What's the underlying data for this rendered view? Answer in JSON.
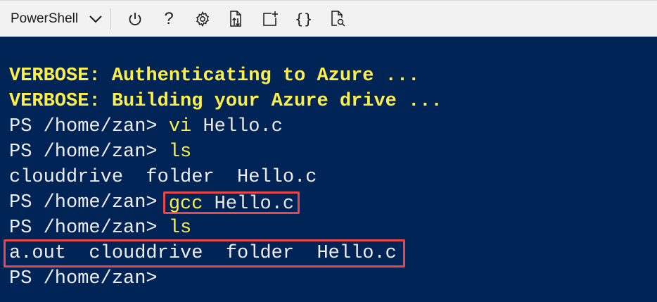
{
  "toolbar": {
    "shell_label": "PowerShell",
    "icons": {
      "chevron": "chevron-down-icon",
      "power": "power-icon",
      "help": "help-icon",
      "settings": "gear-icon",
      "upload": "upload-download-icon",
      "new_session": "new-session-icon",
      "editor": "braces-icon",
      "preview": "web-preview-icon"
    },
    "help_glyph": "?",
    "braces_glyph": "{}"
  },
  "terminal": {
    "background": "#012456",
    "verbose_color": "#fdef4b",
    "highlight_color": "#e8474c",
    "verbose_1": "VERBOSE: Authenticating to Azure ...",
    "verbose_2": "VERBOSE: Building your Azure drive ...",
    "prompt": "PS /home/zan> ",
    "line3_cmd": "vi",
    "line3_arg": " Hello.c",
    "line4_cmd": "ls",
    "line5_output": "clouddrive  folder  Hello.c",
    "line6_cmd": "gcc",
    "line6_arg": " Hello.c",
    "line7_cmd": "ls",
    "line8_output": "a.out  clouddrive  folder  Hello.c",
    "line9_prompt": "PS /home/zan>"
  }
}
